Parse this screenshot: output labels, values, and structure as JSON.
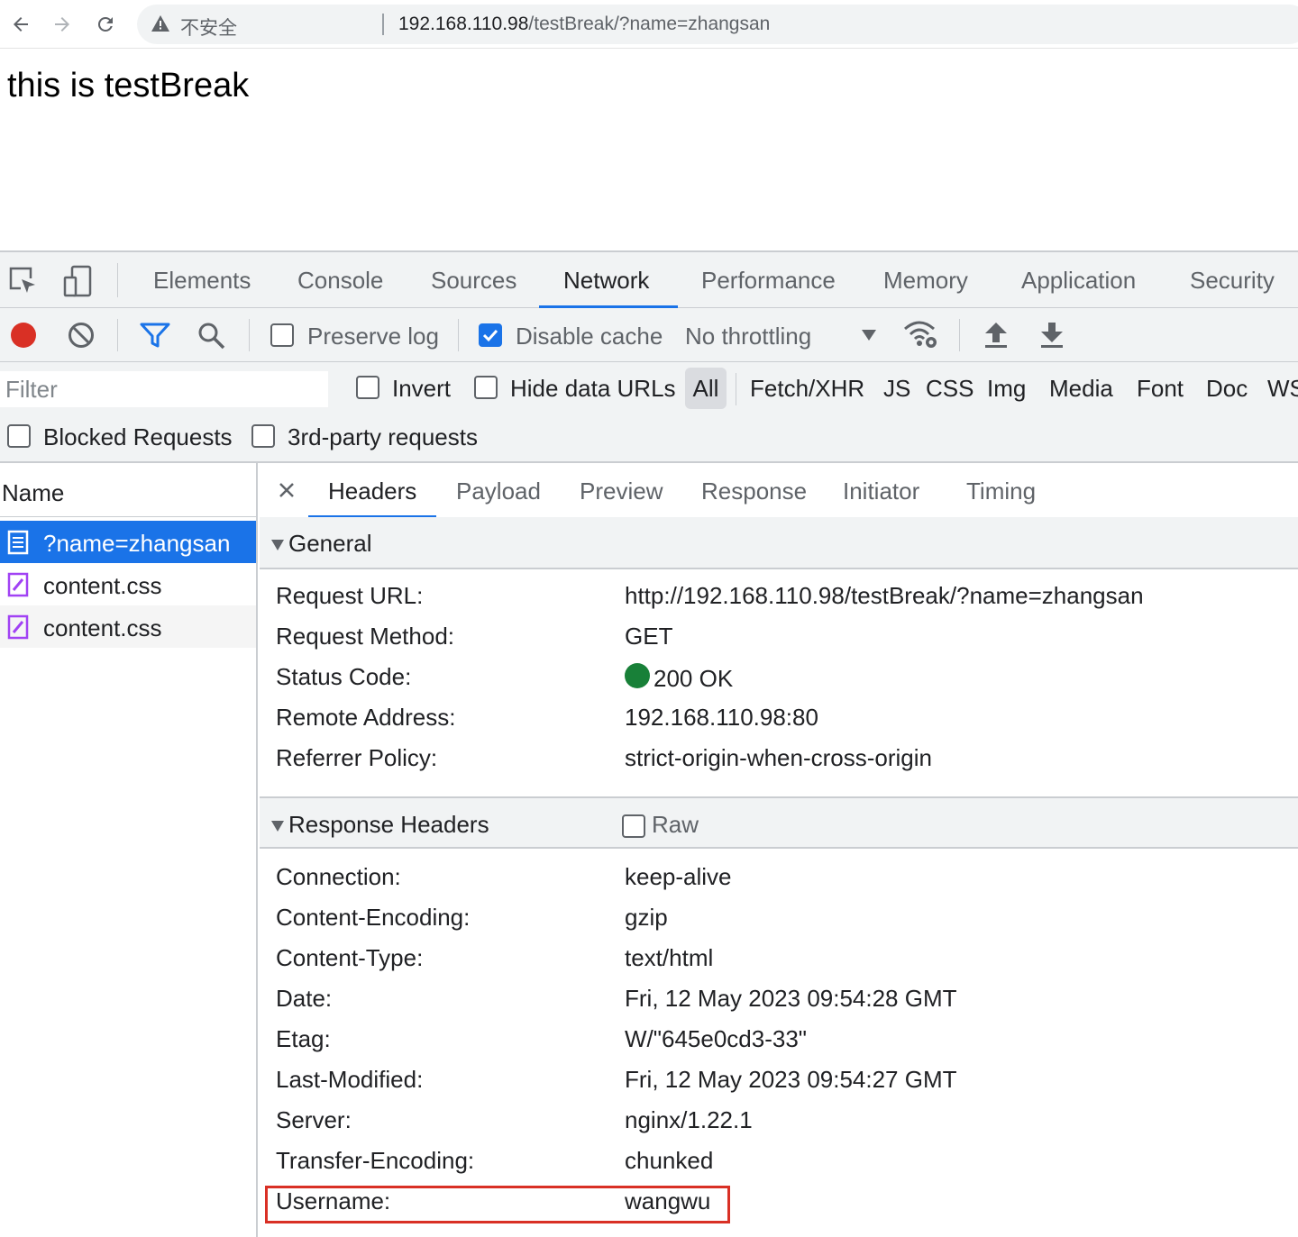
{
  "browser": {
    "insecure_label": "不安全",
    "url_host": "192.168.110.98",
    "url_path": "/testBreak/?name=zhangsan"
  },
  "page": {
    "heading": "this is testBreak"
  },
  "devtools": {
    "tabs": [
      "Elements",
      "Console",
      "Sources",
      "Network",
      "Performance",
      "Memory",
      "Application",
      "Security"
    ],
    "active_tab": "Network",
    "toolbar": {
      "preserve_log": "Preserve log",
      "disable_cache": "Disable cache",
      "throttling": "No throttling"
    },
    "filter": {
      "placeholder": "Filter",
      "invert": "Invert",
      "hide_data_urls": "Hide data URLs",
      "types": [
        "All",
        "Fetch/XHR",
        "JS",
        "CSS",
        "Img",
        "Media",
        "Font",
        "Doc",
        "WS"
      ],
      "blocked_requests": "Blocked Requests",
      "third_party": "3rd-party requests"
    },
    "requests": {
      "header": "Name",
      "items": [
        "?name=zhangsan",
        "content.css",
        "content.css"
      ]
    },
    "detail": {
      "tabs": [
        "Headers",
        "Payload",
        "Preview",
        "Response",
        "Initiator",
        "Timing"
      ],
      "general": {
        "title": "General",
        "rows": [
          {
            "key": "Request URL:",
            "value": "http://192.168.110.98/testBreak/?name=zhangsan"
          },
          {
            "key": "Request Method:",
            "value": "GET"
          },
          {
            "key": "Status Code:",
            "value": "200 OK"
          },
          {
            "key": "Remote Address:",
            "value": "192.168.110.98:80"
          },
          {
            "key": "Referrer Policy:",
            "value": "strict-origin-when-cross-origin"
          }
        ]
      },
      "response_headers": {
        "title": "Response Headers",
        "raw_label": "Raw",
        "rows": [
          {
            "key": "Connection:",
            "value": "keep-alive"
          },
          {
            "key": "Content-Encoding:",
            "value": "gzip"
          },
          {
            "key": "Content-Type:",
            "value": "text/html"
          },
          {
            "key": "Date:",
            "value": "Fri, 12 May 2023 09:54:28 GMT"
          },
          {
            "key": "Etag:",
            "value": "W/\"645e0cd3-33\""
          },
          {
            "key": "Last-Modified:",
            "value": "Fri, 12 May 2023 09:54:27 GMT"
          },
          {
            "key": "Server:",
            "value": "nginx/1.22.1"
          },
          {
            "key": "Transfer-Encoding:",
            "value": "chunked"
          },
          {
            "key": "Username:",
            "value": "wangwu"
          }
        ]
      }
    }
  }
}
